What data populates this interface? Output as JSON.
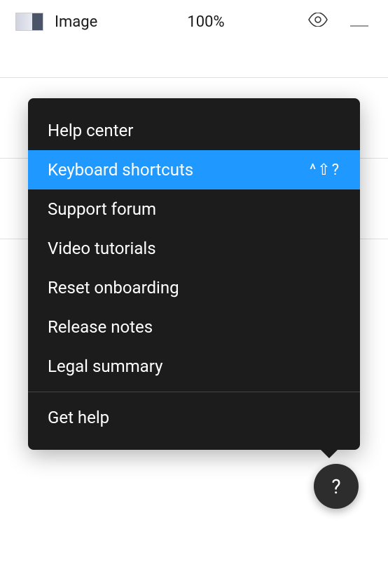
{
  "layer": {
    "name": "Image",
    "opacity": "100%"
  },
  "menu": {
    "items": [
      {
        "label": "Help center",
        "shortcut": "",
        "highlighted": false
      },
      {
        "label": "Keyboard shortcuts",
        "shortcut": "^⇧?",
        "highlighted": true
      },
      {
        "label": "Support forum",
        "shortcut": "",
        "highlighted": false
      },
      {
        "label": "Video tutorials",
        "shortcut": "",
        "highlighted": false
      },
      {
        "label": "Reset onboarding",
        "shortcut": "",
        "highlighted": false
      },
      {
        "label": "Release notes",
        "shortcut": "",
        "highlighted": false
      },
      {
        "label": "Legal summary",
        "shortcut": "",
        "highlighted": false
      }
    ],
    "footer": {
      "label": "Get help"
    }
  },
  "fab": {
    "label": "?"
  }
}
